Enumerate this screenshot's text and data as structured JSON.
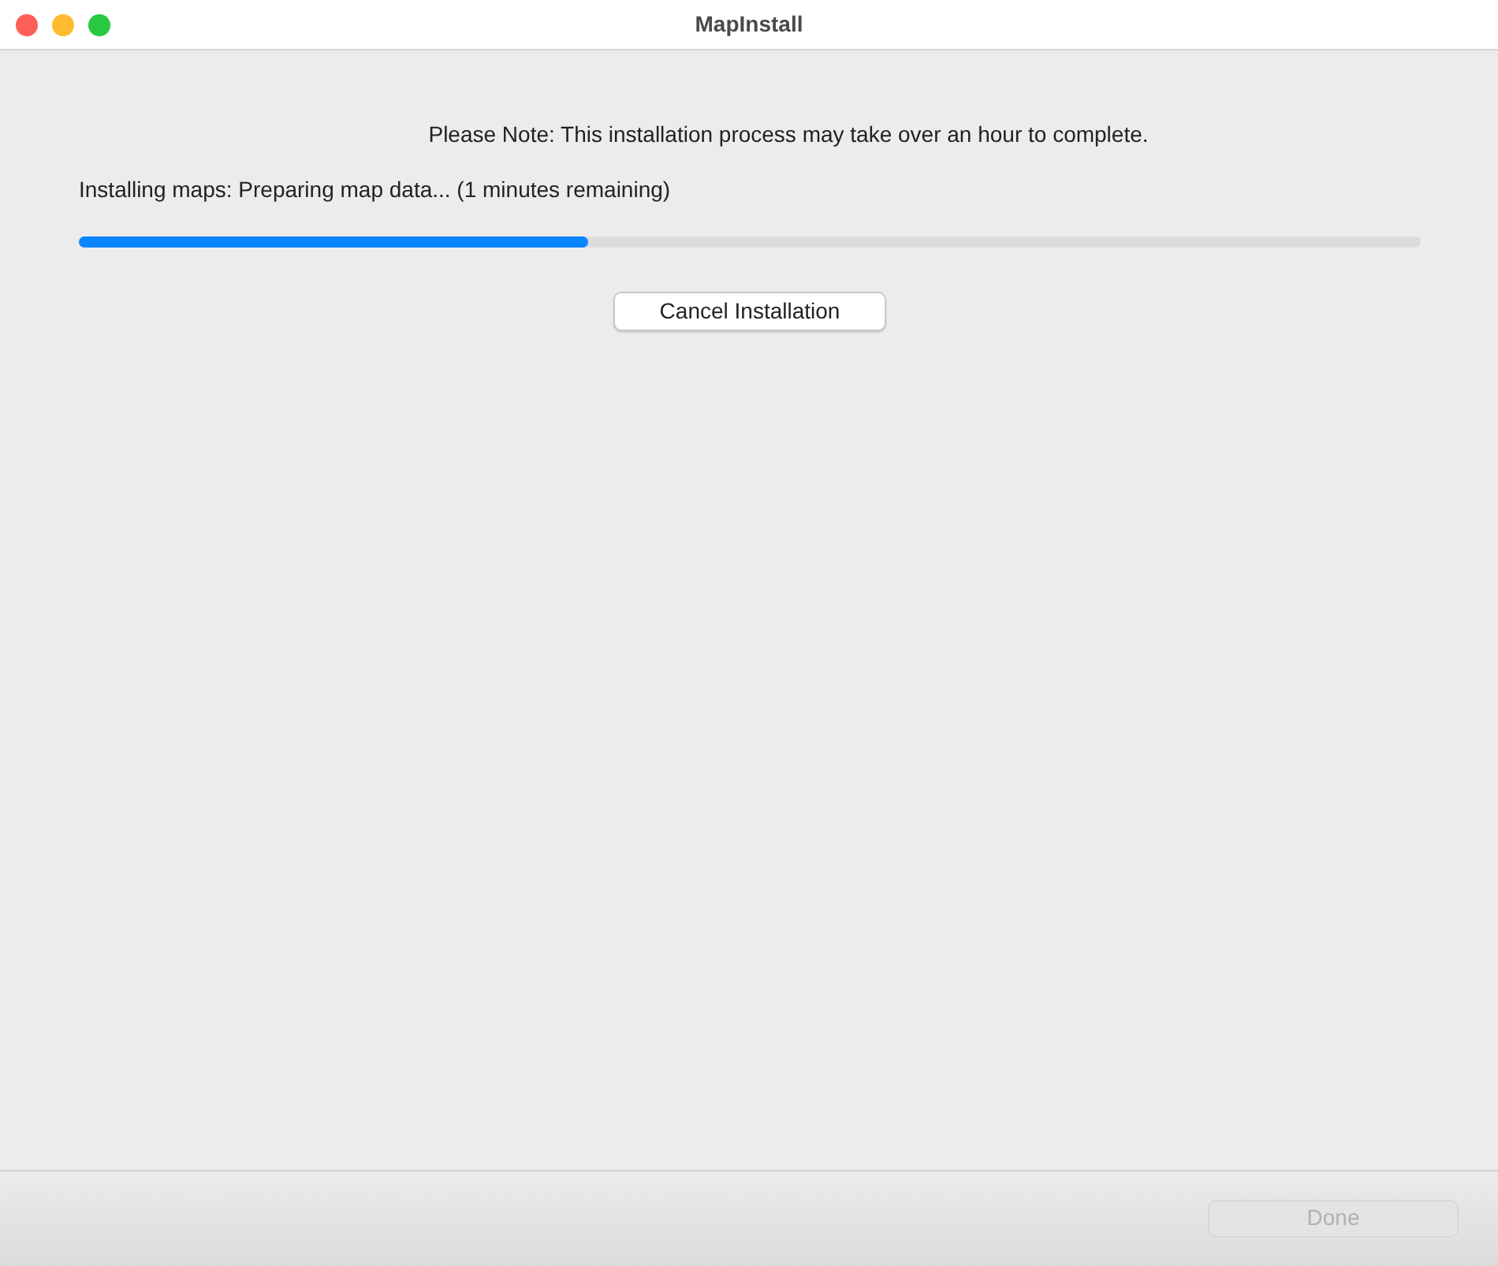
{
  "window": {
    "title": "MapInstall"
  },
  "note": "Please Note: This installation process may take over an hour to complete.",
  "status": "Installing maps: Preparing map data... (1 minutes remaining)",
  "progress": {
    "level": 0.38
  },
  "cancel_button": {
    "label": "Cancel Installation",
    "disabled": false
  },
  "done_button": {
    "label": "Done",
    "disabled": true
  }
}
